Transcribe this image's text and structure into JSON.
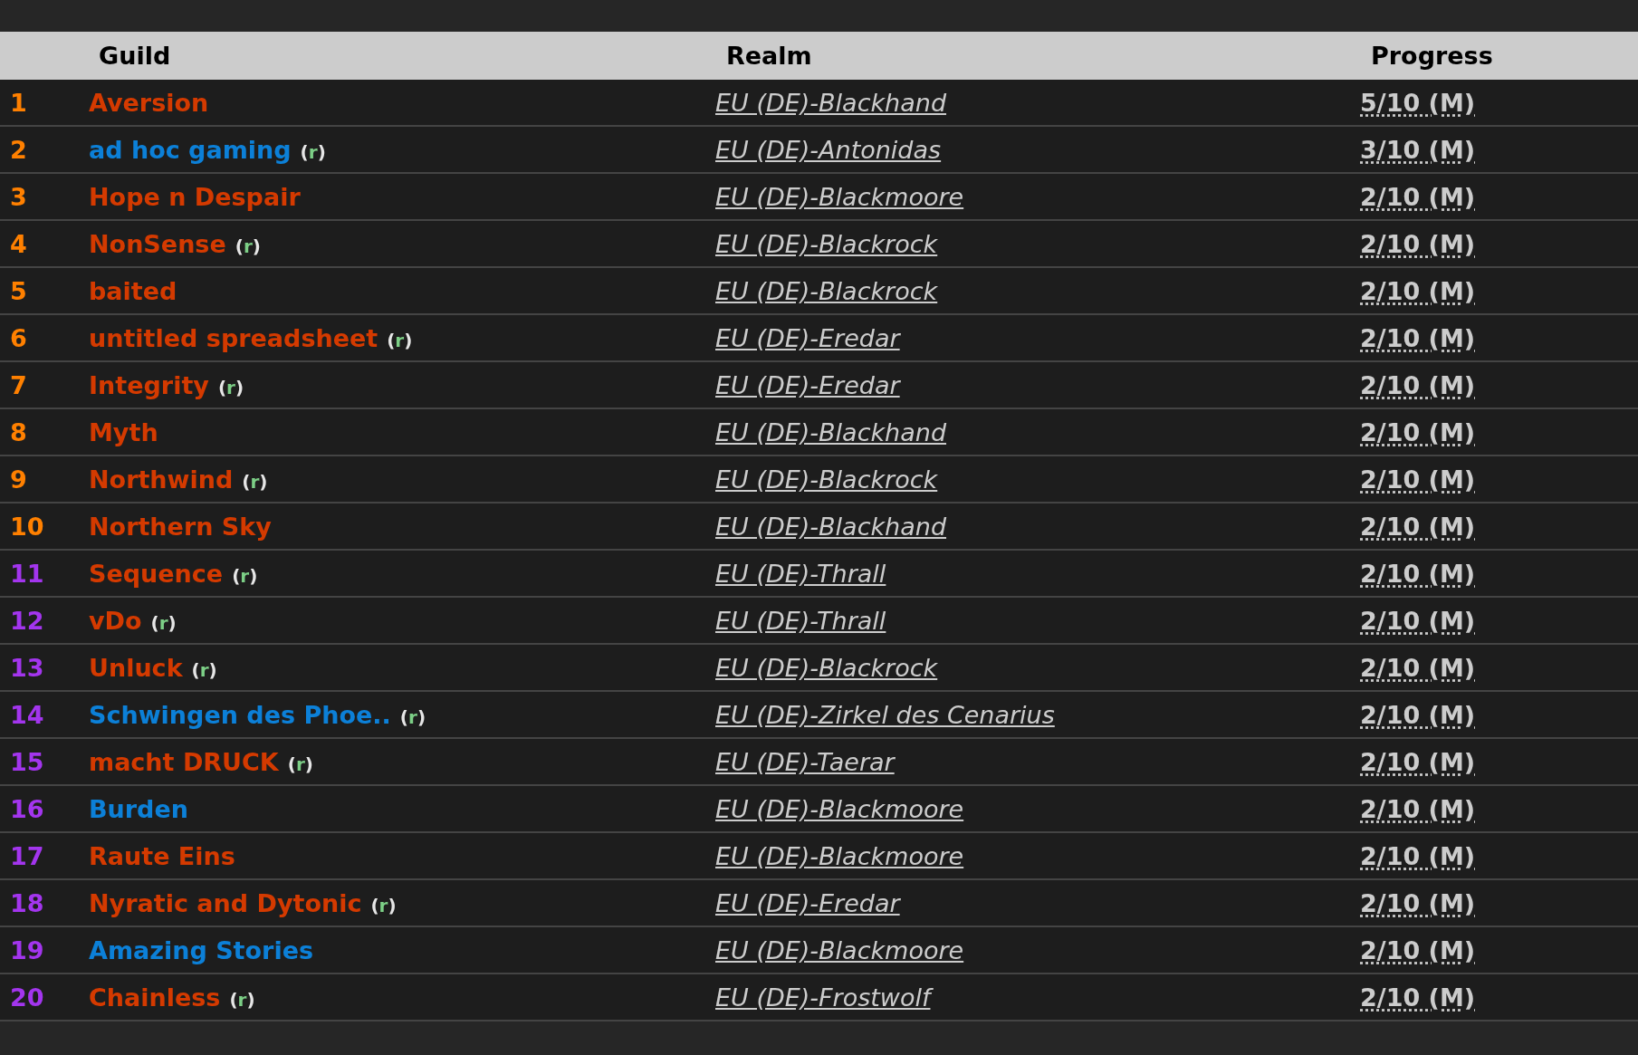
{
  "table": {
    "columns": [
      "Guild",
      "Realm",
      "Progress"
    ],
    "rows": [
      {
        "rank": {
          "text": "1",
          "color": "#ff8000"
        },
        "guild": {
          "name": "Aversion",
          "color": "#d43a00"
        },
        "realm": "EU (DE)-Blackhand",
        "progress": "5/10 (M)"
      },
      {
        "rank": {
          "text": "2",
          "color": "#ff8000"
        },
        "guild": {
          "name": "ad hoc gaming",
          "color": "#0c80d8",
          "tag": "(r)"
        },
        "realm": "EU (DE)-Antonidas",
        "progress": "3/10 (M)"
      },
      {
        "rank": {
          "text": "3",
          "color": "#ff8000"
        },
        "guild": {
          "name": "Hope n Despair",
          "color": "#d43a00"
        },
        "realm": "EU (DE)-Blackmoore",
        "progress": "2/10 (M)"
      },
      {
        "rank": {
          "text": "4",
          "color": "#ff8000"
        },
        "guild": {
          "name": "NonSense",
          "color": "#d43a00",
          "tag": "(r)"
        },
        "realm": "EU (DE)-Blackrock",
        "progress": "2/10 (M)"
      },
      {
        "rank": {
          "text": "5",
          "color": "#ff8000"
        },
        "guild": {
          "name": "baited",
          "color": "#d43a00"
        },
        "realm": "EU (DE)-Blackrock",
        "progress": "2/10 (M)"
      },
      {
        "rank": {
          "text": "6",
          "color": "#ff8000"
        },
        "guild": {
          "name": "untitled spreadsheet",
          "color": "#d43a00",
          "tag": "(r)"
        },
        "realm": "EU (DE)-Eredar",
        "progress": "2/10 (M)"
      },
      {
        "rank": {
          "text": "7",
          "color": "#ff8000"
        },
        "guild": {
          "name": "Integrity",
          "color": "#d43a00",
          "tag": "(r)"
        },
        "realm": "EU (DE)-Eredar",
        "progress": "2/10 (M)"
      },
      {
        "rank": {
          "text": "8",
          "color": "#ff8000"
        },
        "guild": {
          "name": "Myth",
          "color": "#d43a00"
        },
        "realm": "EU (DE)-Blackhand",
        "progress": "2/10 (M)"
      },
      {
        "rank": {
          "text": "9",
          "color": "#ff8000"
        },
        "guild": {
          "name": "Northwind",
          "color": "#d43a00",
          "tag": "(r)"
        },
        "realm": "EU (DE)-Blackrock",
        "progress": "2/10 (M)"
      },
      {
        "rank": {
          "text": "10",
          "color": "#ff8000"
        },
        "guild": {
          "name": "Northern Sky",
          "color": "#d43a00"
        },
        "realm": "EU (DE)-Blackhand",
        "progress": "2/10 (M)"
      },
      {
        "rank": {
          "text": "11",
          "color": "#a335ee"
        },
        "guild": {
          "name": "Sequence",
          "color": "#d43a00",
          "tag": "(r)"
        },
        "realm": "EU (DE)-Thrall",
        "progress": "2/10 (M)"
      },
      {
        "rank": {
          "text": "12",
          "color": "#a335ee"
        },
        "guild": {
          "name": "vDo",
          "color": "#d43a00",
          "tag": "(r)"
        },
        "realm": "EU (DE)-Thrall",
        "progress": "2/10 (M)"
      },
      {
        "rank": {
          "text": "13",
          "color": "#a335ee"
        },
        "guild": {
          "name": "Unluck",
          "color": "#d43a00",
          "tag": "(r)"
        },
        "realm": "EU (DE)-Blackrock",
        "progress": "2/10 (M)"
      },
      {
        "rank": {
          "text": "14",
          "color": "#a335ee"
        },
        "guild": {
          "name": "Schwingen des Phoe..",
          "color": "#0c80d8",
          "tag": "(r)"
        },
        "realm": "EU (DE)-Zirkel des Cenarius",
        "progress": "2/10 (M)"
      },
      {
        "rank": {
          "text": "15",
          "color": "#a335ee"
        },
        "guild": {
          "name": "macht DRUCK",
          "color": "#d43a00",
          "tag": "(r)"
        },
        "realm": "EU (DE)-Taerar",
        "progress": "2/10 (M)"
      },
      {
        "rank": {
          "text": "16",
          "color": "#a335ee"
        },
        "guild": {
          "name": "Burden",
          "color": "#0c80d8"
        },
        "realm": "EU (DE)-Blackmoore",
        "progress": "2/10 (M)"
      },
      {
        "rank": {
          "text": "17",
          "color": "#a335ee"
        },
        "guild": {
          "name": "Raute Eins",
          "color": "#d43a00"
        },
        "realm": "EU (DE)-Blackmoore",
        "progress": "2/10 (M)"
      },
      {
        "rank": {
          "text": "18",
          "color": "#a335ee"
        },
        "guild": {
          "name": "Nyratic and Dytonic",
          "color": "#d43a00",
          "tag": "(r)"
        },
        "realm": "EU (DE)-Eredar",
        "progress": "2/10 (M)"
      },
      {
        "rank": {
          "text": "19",
          "color": "#a335ee"
        },
        "guild": {
          "name": "Amazing Stories",
          "color": "#0c80d8"
        },
        "realm": "EU (DE)-Blackmoore",
        "progress": "2/10 (M)"
      },
      {
        "rank": {
          "text": "20",
          "color": "#a335ee"
        },
        "guild": {
          "name": "Chainless",
          "color": "#d43a00",
          "tag": "(r)"
        },
        "realm": "EU (DE)-Frostwolf",
        "progress": "2/10 (M)"
      }
    ]
  }
}
